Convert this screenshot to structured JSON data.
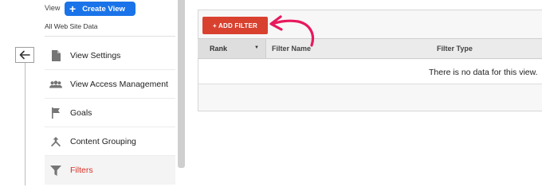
{
  "header": {
    "view_label": "View",
    "create_view_label": "Create View",
    "property_label": "All Web Site Data"
  },
  "sidebar": {
    "items": [
      {
        "label": "View Settings",
        "icon": "document-icon"
      },
      {
        "label": "View Access Management",
        "icon": "people-icon"
      },
      {
        "label": "Goals",
        "icon": "flag-icon"
      },
      {
        "label": "Content Grouping",
        "icon": "merge-icon"
      },
      {
        "label": "Filters",
        "icon": "filter-icon",
        "active": true
      }
    ]
  },
  "filters_panel": {
    "add_filter_label": "+ ADD FILTER",
    "columns": [
      "Rank",
      "Filter Name",
      "Filter Type"
    ],
    "empty_message": "There is no data for this view."
  },
  "colors": {
    "accent_blue": "#1a73e8",
    "add_filter_red": "#d9412f",
    "active_item_red": "#d93025",
    "annotation_arrow": "#e8185c"
  }
}
